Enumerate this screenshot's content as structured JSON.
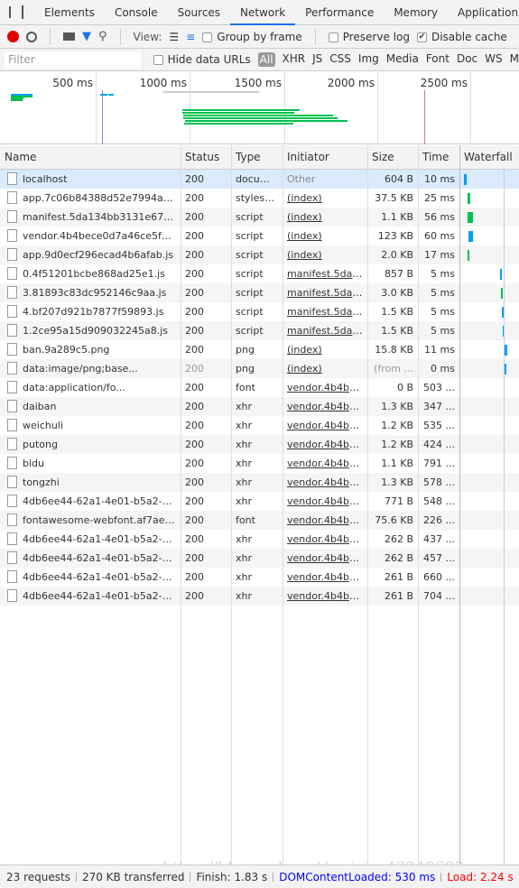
{
  "tabs": [
    "Elements",
    "Console",
    "Sources",
    "Network",
    "Performance",
    "Memory",
    "Application"
  ],
  "active_tab": "Network",
  "toolbar": {
    "view_label": "View:",
    "group_by_frame": "Group by frame",
    "group_by_frame_checked": false,
    "preserve_log": "Preserve log",
    "preserve_log_checked": false,
    "disable_cache": "Disable cache",
    "disable_cache_checked": true
  },
  "filterbar": {
    "placeholder": "Filter",
    "hide_data_urls": "Hide data URLs",
    "types": [
      "All",
      "XHR",
      "JS",
      "CSS",
      "Img",
      "Media",
      "Font",
      "Doc",
      "WS",
      "M"
    ]
  },
  "overview": {
    "ticks": [
      "500 ms",
      "1000 ms",
      "1500 ms",
      "2000 ms",
      "2500 ms"
    ]
  },
  "columns": [
    "Name",
    "Status",
    "Type",
    "Initiator",
    "Size",
    "Time",
    "Waterfall"
  ],
  "rows": [
    {
      "name": "localhost",
      "status": "200",
      "type": "docum...",
      "initiator": "Other",
      "size": "604 B",
      "time": "10 ms"
    },
    {
      "name": "app.7c06b84388d52e7994a0d...",
      "status": "200",
      "type": "stylesh...",
      "initiator": "(index)",
      "size": "37.5 KB",
      "time": "25 ms"
    },
    {
      "name": "manifest.5da134bb3131e67f0...",
      "status": "200",
      "type": "script",
      "initiator": "(index)",
      "size": "1.1 KB",
      "time": "56 ms"
    },
    {
      "name": "vendor.4b4bece0d7a46ce5fae...",
      "status": "200",
      "type": "script",
      "initiator": "(index)",
      "size": "123 KB",
      "time": "60 ms"
    },
    {
      "name": "app.9d0ecf296ecad4b6afab.js",
      "status": "200",
      "type": "script",
      "initiator": "(index)",
      "size": "2.0 KB",
      "time": "17 ms"
    },
    {
      "name": "0.4f51201bcbe868ad25e1.js",
      "status": "200",
      "type": "script",
      "initiator": "manifest.5da1...",
      "size": "857 B",
      "time": "5 ms"
    },
    {
      "name": "3.81893c83dc952146c9aa.js",
      "status": "200",
      "type": "script",
      "initiator": "manifest.5da1...",
      "size": "3.0 KB",
      "time": "5 ms"
    },
    {
      "name": "4.bf207d921b7877f59893.js",
      "status": "200",
      "type": "script",
      "initiator": "manifest.5da1...",
      "size": "1.5 KB",
      "time": "5 ms"
    },
    {
      "name": "1.2ce95a15d909032245a8.js",
      "status": "200",
      "type": "script",
      "initiator": "manifest.5da1...",
      "size": "1.5 KB",
      "time": "5 ms"
    },
    {
      "name": "ban.9a289c5.png",
      "status": "200",
      "type": "png",
      "initiator": "(index)",
      "size": "15.8 KB",
      "time": "11 ms"
    },
    {
      "name": "data:image/png;base...",
      "status": "200",
      "type": "png",
      "initiator": "(index)",
      "size": "(from ...",
      "time": "0 ms"
    },
    {
      "name": "data:application/fo...",
      "status": "200",
      "type": "font",
      "initiator": "vendor.4b4be...",
      "size": "0 B",
      "time": "503 ..."
    },
    {
      "name": "daiban",
      "status": "200",
      "type": "xhr",
      "initiator": "vendor.4b4be...",
      "size": "1.3 KB",
      "time": "347 ..."
    },
    {
      "name": "weichuli",
      "status": "200",
      "type": "xhr",
      "initiator": "vendor.4b4be...",
      "size": "1.2 KB",
      "time": "535 ..."
    },
    {
      "name": "putong",
      "status": "200",
      "type": "xhr",
      "initiator": "vendor.4b4be...",
      "size": "1.2 KB",
      "time": "424 ..."
    },
    {
      "name": "bidu",
      "status": "200",
      "type": "xhr",
      "initiator": "vendor.4b4be...",
      "size": "1.1 KB",
      "time": "791 ..."
    },
    {
      "name": "tongzhi",
      "status": "200",
      "type": "xhr",
      "initiator": "vendor.4b4be...",
      "size": "1.3 KB",
      "time": "578 ..."
    },
    {
      "name": "4db6ee44-62a1-4e01-b5a2-2...",
      "status": "200",
      "type": "xhr",
      "initiator": "vendor.4b4be...",
      "size": "771 B",
      "time": "548 ..."
    },
    {
      "name": "fontawesome-webfont.af7ae5...",
      "status": "200",
      "type": "font",
      "initiator": "vendor.4b4be...",
      "size": "75.6 KB",
      "time": "226 ..."
    },
    {
      "name": "4db6ee44-62a1-4e01-b5a2-2...",
      "status": "200",
      "type": "xhr",
      "initiator": "vendor.4b4be...",
      "size": "262 B",
      "time": "437 ..."
    },
    {
      "name": "4db6ee44-62a1-4e01-b5a2-2...",
      "status": "200",
      "type": "xhr",
      "initiator": "vendor.4b4be...",
      "size": "262 B",
      "time": "457 ..."
    },
    {
      "name": "4db6ee44-62a1-4e01-b5a2-2...",
      "status": "200",
      "type": "xhr",
      "initiator": "vendor.4b4be...",
      "size": "261 B",
      "time": "660 ..."
    },
    {
      "name": "4db6ee44-62a1-4e01-b5a2-2...",
      "status": "200",
      "type": "xhr",
      "initiator": "vendor.4b4be...",
      "size": "261 B",
      "time": "704 ..."
    }
  ],
  "summary": {
    "requests": "23 requests",
    "transferred": "270 KB transferred",
    "finish": "Finish: 1.83 s",
    "dcl": "DOMContentLoaded: 530 ms",
    "load": "Load: 2.24 s"
  },
  "watermark": "https://blog.csdn.net/weixin_43249693",
  "colors": {
    "accent": "#1a73e8",
    "dcl": "#0000ff",
    "load": "#ff0000",
    "record": "#e00000",
    "bar_green": "#00c050",
    "bar_blue": "#00a0f0"
  }
}
